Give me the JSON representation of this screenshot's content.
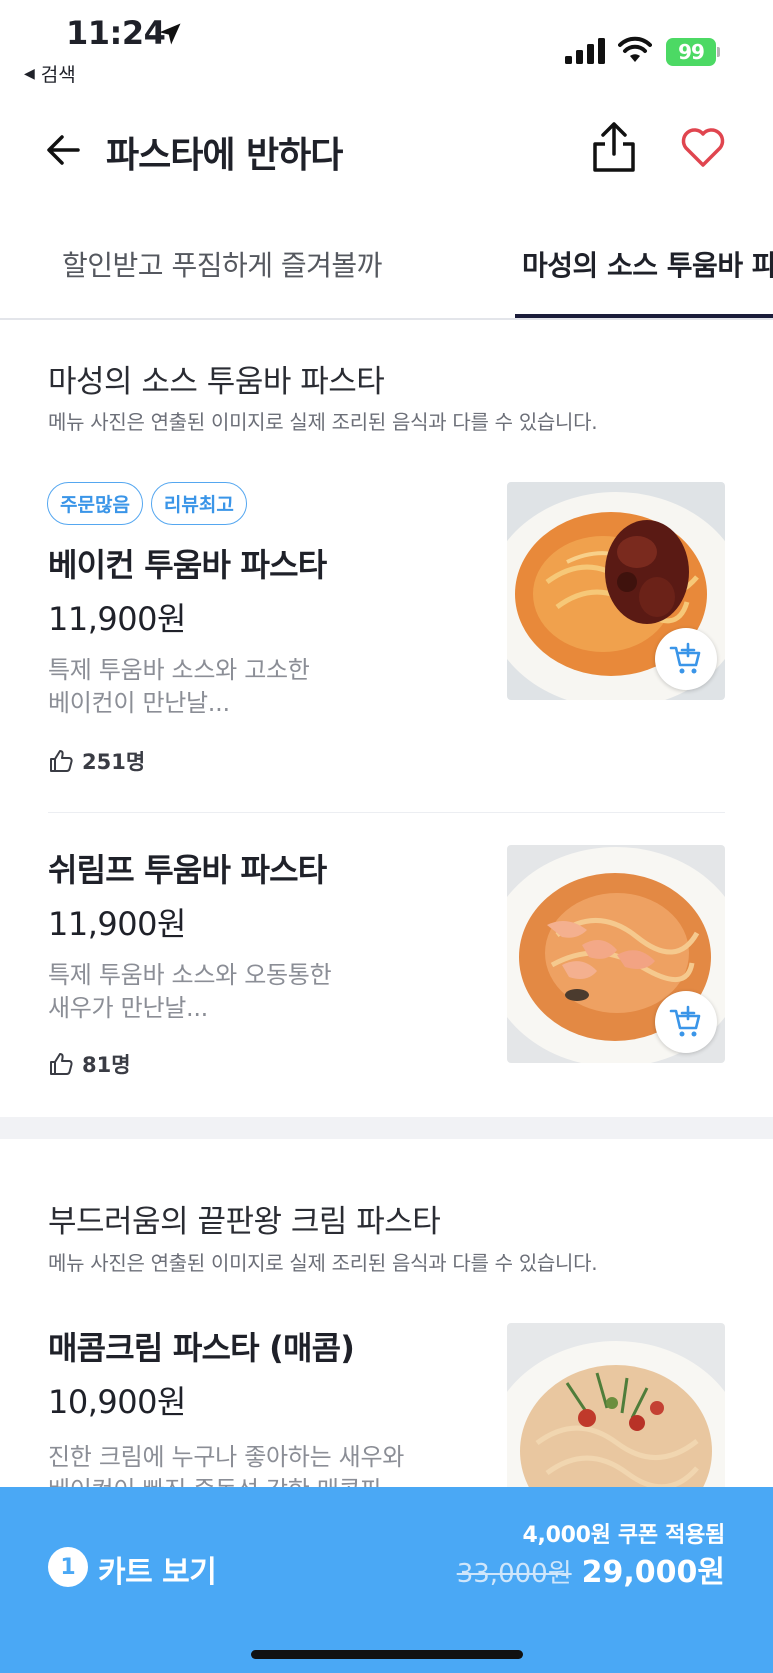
{
  "status_bar": {
    "time": "11:24",
    "back_app": "검색",
    "battery": "99"
  },
  "header": {
    "title": "파스타에 반하다"
  },
  "tabs": [
    {
      "label": "할인받고 푸짐하게 즐겨볼까"
    },
    {
      "label": "마성의 소스 투움바 파"
    }
  ],
  "sections": [
    {
      "title": "마성의 소스 투움바 파스타",
      "note": "메뉴 사진은 연출된 이미지로 실제 조리된 음식과 다를 수 있습니다.",
      "items": [
        {
          "badges": [
            "주문많음",
            "리뷰최고"
          ],
          "name": "베이컨 투움바 파스타",
          "price": "11,900원",
          "desc_line1": "특제 투움바 소스와 고소한",
          "desc_line2": "베이컨이 만난날...",
          "likes": "251명"
        },
        {
          "name": "쉬림프 투움바 파스타",
          "price": "11,900원",
          "desc_line1": "특제 투움바 소스와 오동통한",
          "desc_line2": "새우가 만난날...",
          "likes": "81명"
        }
      ]
    },
    {
      "title": "부드러움의 끝판왕 크림 파스타",
      "note": "메뉴 사진은 연출된 이미지로 실제 조리된 음식과 다를 수 있습니다.",
      "items": [
        {
          "name": "매콤크림 파스타 (매콤)",
          "price": "10,900원",
          "desc_line1": "진한 크림에 누구나 좋아하는 새우와",
          "desc_line2": "베이컨이 빠진 중독성 강한 매콤파"
        }
      ]
    }
  ],
  "cart": {
    "count": "1",
    "label": "카트 보기",
    "coupon": "4,000원 쿠폰 적용됨",
    "original_price": "33,000원",
    "final_price": "29,000원"
  },
  "colors": {
    "accent": "#4aa8f5",
    "badge": "#3a95e8",
    "heart": "#e0454f"
  }
}
